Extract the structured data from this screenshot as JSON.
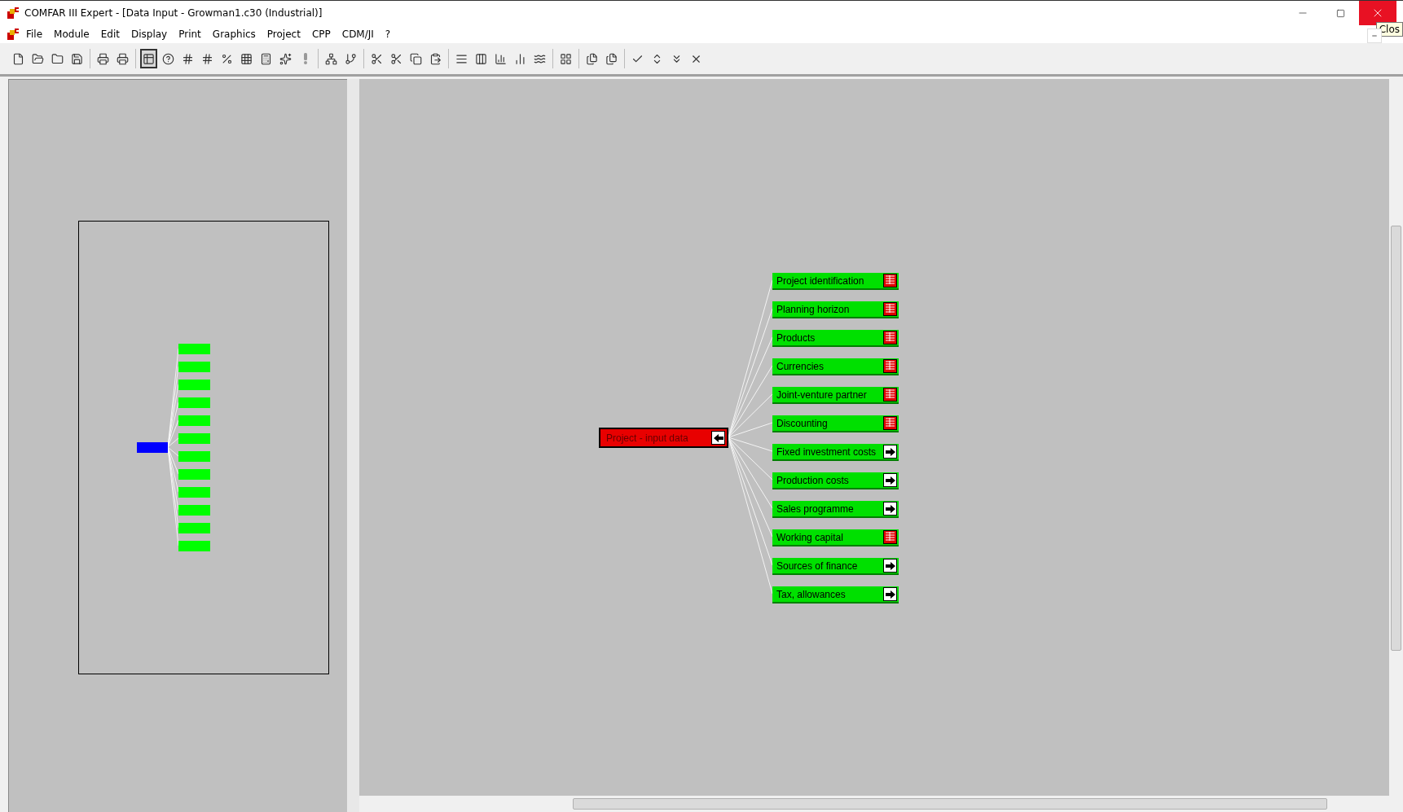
{
  "window": {
    "title": "COMFAR III Expert - [Data Input - Growman1.c30 (Industrial)]",
    "tooltip": "Clos"
  },
  "menu": [
    "File",
    "Module",
    "Edit",
    "Display",
    "Print",
    "Graphics",
    "Project",
    "CPP",
    "CDM/JI",
    "?"
  ],
  "diagram": {
    "root": {
      "label": "Project - input data"
    },
    "nodes": [
      {
        "label": "Project identification",
        "kind": "table"
      },
      {
        "label": "Planning horizon",
        "kind": "table"
      },
      {
        "label": "Products",
        "kind": "table"
      },
      {
        "label": "Currencies",
        "kind": "table"
      },
      {
        "label": "Joint-venture partner",
        "kind": "table"
      },
      {
        "label": "Discounting",
        "kind": "table"
      },
      {
        "label": "Fixed investment costs",
        "kind": "arrow"
      },
      {
        "label": "Production costs",
        "kind": "arrow"
      },
      {
        "label": "Sales programme",
        "kind": "arrow"
      },
      {
        "label": "Working capital",
        "kind": "table"
      },
      {
        "label": "Sources of finance",
        "kind": "arrow"
      },
      {
        "label": "Tax, allowances",
        "kind": "arrow"
      }
    ]
  }
}
